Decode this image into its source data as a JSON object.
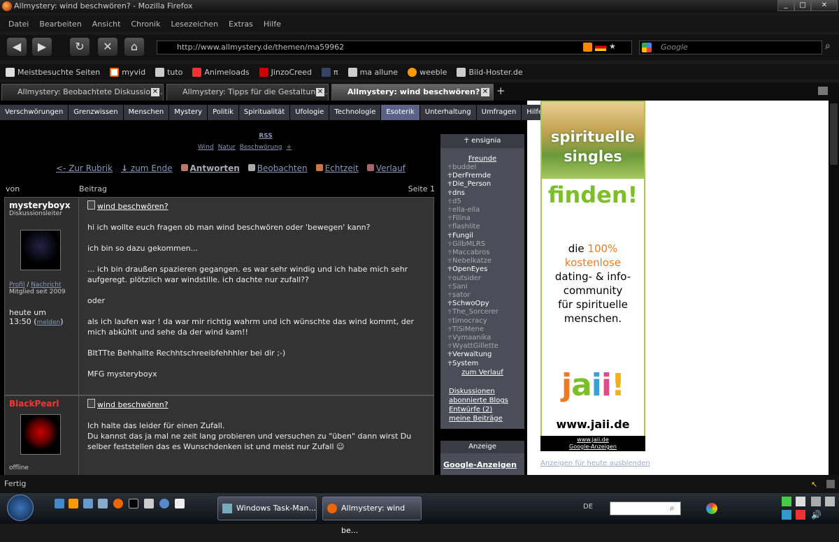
{
  "window": {
    "title": "Allmystery: wind beschwören? - Mozilla Firefox"
  },
  "menu": [
    "Datei",
    "Bearbeiten",
    "Ansicht",
    "Chronik",
    "Lesezeichen",
    "Extras",
    "Hilfe"
  ],
  "url": "http://www.allmystery.de/themen/ma59962",
  "search_placeholder": "Google",
  "bookmarks": [
    "Meistbesuchte Seiten",
    "myvid",
    "tuto",
    "Animeloads",
    "JinzoCreed",
    "π",
    "ma allune",
    "weeble",
    "Bild-Hoster.de"
  ],
  "tabs": [
    "Allmystery: Beobachtete Diskussion...",
    "Allmystery: Tipps für die Gestaltung...",
    "Allmystery: wind beschwören?"
  ],
  "site_nav": [
    "Verschwörungen",
    "Grenzwissen",
    "Menschen",
    "Mystery",
    "Politik",
    "Spiritualität",
    "Ufologie",
    "Technologie",
    "Esoterik",
    "Unterhaltung",
    "Umfragen",
    "Hilfe"
  ],
  "rss": "RSS",
  "tags": [
    "Wind",
    "Natur",
    "Beschwörung",
    "+"
  ],
  "actions": [
    "<- Zur Rubrik",
    "zum Ende",
    "Antworten",
    "Beobachten",
    "Echtzeit",
    "Verlauf"
  ],
  "thead": {
    "von": "von",
    "beitrag": "Beitrag",
    "seite": "Seite 1"
  },
  "post1": {
    "user": "mysteryboyx",
    "role": "Diskussionsleiter",
    "profil": "Profil",
    "nachricht": "Nachricht",
    "member": "Mitglied seit 2009",
    "time1": "heute um",
    "time2": "13:50 (",
    "melden": "melden",
    "time3": ")",
    "title": "wind beschwören?",
    "lines": [
      "hi ich wollte euch fragen ob man wind beschwören oder 'bewegen' kann?",
      "ich bin so dazu gekommen...",
      "... ich bin draußen spazieren gegangen. es war sehr windig und ich habe mich sehr aufgeregt. plötzlich war windstille. ich dachte nur zufall??",
      "oder",
      "als ich laufen war ! da war mir richtig wahrm und ich wünschte das wind kommt, der mich abkühlt und sehe da der wind kam!!",
      "BItTTte Behhallte Rechhtschreeibfehhhler bei dir ;-)",
      "MFG mysteryboyx"
    ]
  },
  "post2": {
    "user": "BlackPearl",
    "title": "wind beschwören?",
    "lines": [
      "Ich halte das leider für einen Zufall.",
      "Du kannst das ja mal ne zeit lang probieren und versuchen zu \"üben\" dann wirst Du selber feststellen das es Wunschdenken ist und meist nur Zufall ☺"
    ],
    "status": "offline"
  },
  "sidebar": {
    "header": "ensignia",
    "freunde": "Freunde",
    "friends": [
      {
        "name": "buddel",
        "online": false
      },
      {
        "name": "DerFremde",
        "online": true
      },
      {
        "name": "Die_Person",
        "online": true
      },
      {
        "name": "dns",
        "online": true
      },
      {
        "name": "d5",
        "online": false
      },
      {
        "name": "ella-ella",
        "online": false
      },
      {
        "name": "Filina",
        "online": false
      },
      {
        "name": "flashlite",
        "online": false
      },
      {
        "name": "Fungil",
        "online": true
      },
      {
        "name": "GilbMLRS",
        "online": false
      },
      {
        "name": "Maccabros",
        "online": false
      },
      {
        "name": "Nebelkatze",
        "online": false
      },
      {
        "name": "OpenEyes",
        "online": true
      },
      {
        "name": "outsider",
        "online": false
      },
      {
        "name": "Sani",
        "online": false
      },
      {
        "name": "sator",
        "online": false
      },
      {
        "name": "SchwoOpy",
        "online": true
      },
      {
        "name": "The_Sorcerer",
        "online": false
      },
      {
        "name": "timocracy",
        "online": false
      },
      {
        "name": "TiSiMene",
        "online": false
      },
      {
        "name": "Vymaanika",
        "online": false
      },
      {
        "name": "WyattGillette",
        "online": false
      },
      {
        "name": "Verwaltung",
        "online": true
      },
      {
        "name": "System",
        "online": true
      }
    ],
    "verlauf": "zum Verlauf",
    "links": [
      "Diskussionen",
      "abonnierte Blogs",
      "Entwürfe (2)",
      "meine Beiträge"
    ]
  },
  "ad": {
    "anzeige": "Anzeige",
    "google": "Google-Anzeigen",
    "t1": "spirituelle",
    "t2": "singles",
    "finden": "finden!",
    "b1": "die",
    "b1o": "100%",
    "b2": "kostenlose",
    "b3": "dating- & info-",
    "b4": "community",
    "b5": "für spirituelle",
    "b6": "menschen.",
    "logo": "jaii!",
    "url": "www.jaii.de",
    "foot1": "www.jaii.de",
    "foot2": "Google-Anzeigen",
    "hide": "Anzeigen für heute ausblenden"
  },
  "status": "Fertig",
  "taskbar": {
    "task1": "Windows Task-Man...",
    "task2": "Allmystery: wind be...",
    "lang": "DE"
  }
}
